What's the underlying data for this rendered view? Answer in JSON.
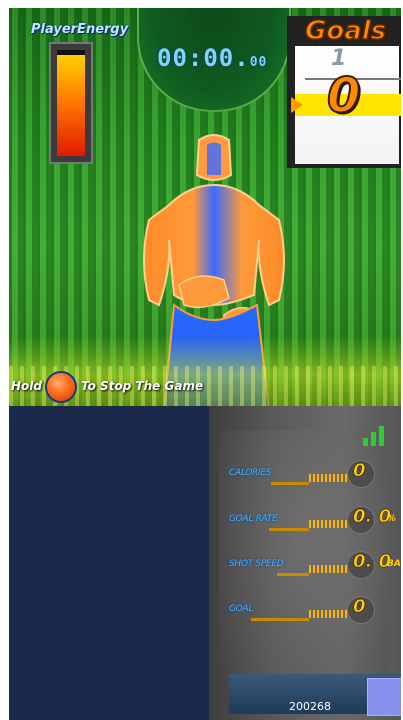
{
  "hud": {
    "energy_label": "PlayerEnergy",
    "energy_level": 0.95,
    "timer_main": "00:00.",
    "timer_fraction": "00",
    "goals_title": "Goals",
    "goals_next": "1",
    "goals_current": "0"
  },
  "hint": {
    "prefix": "Hold",
    "suffix": "To Stop The Game"
  },
  "stats": [
    {
      "label": "CALORIES",
      "value": "0",
      "unit": ""
    },
    {
      "label": "GOAL RATE",
      "value": "0. 0",
      "unit": "%"
    },
    {
      "label": "SHOT SPEED",
      "value": "0. 0",
      "unit": "BALL/S"
    },
    {
      "label": "GOAL",
      "value": "0",
      "unit": ""
    }
  ],
  "footer": {
    "code": "200268"
  },
  "colors": {
    "accent": "#ff8a00",
    "stat_value": "#ffd000",
    "stat_label": "#4ab0ff",
    "panel_bg": "#1b2a4a"
  }
}
